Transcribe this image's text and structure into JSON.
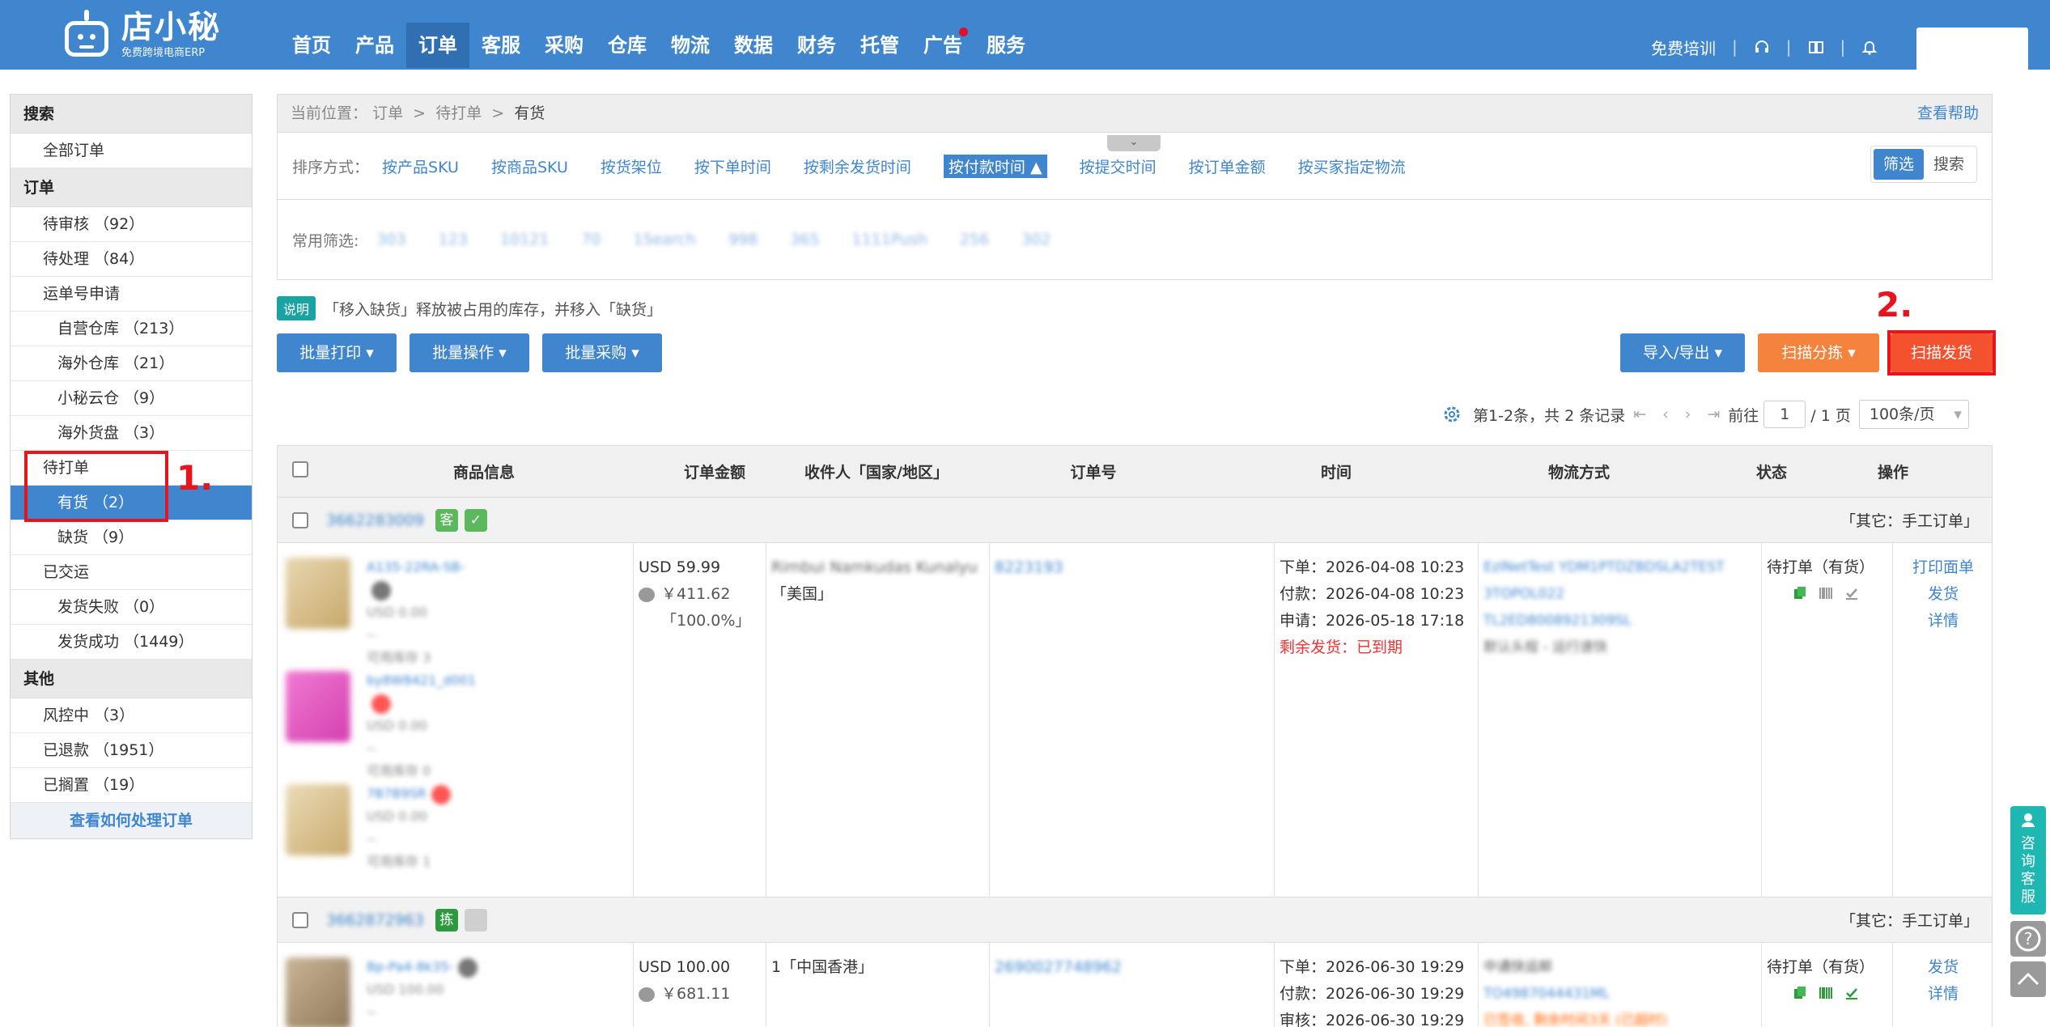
{
  "brand": {
    "name": "店小秘",
    "tagline": "免费跨境电商ERP"
  },
  "nav": {
    "items": [
      "首页",
      "产品",
      "订单",
      "客服",
      "采购",
      "仓库",
      "物流",
      "数据",
      "财务",
      "托管",
      "广告",
      "服务"
    ],
    "active": "订单"
  },
  "topbar": {
    "training": "免费培训"
  },
  "sidebar": {
    "search_head": "搜索",
    "all_orders": "全部订单",
    "orders_head": "订单",
    "pending_review": "待审核 （92）",
    "pending_process": "待处理 （84）",
    "waybill_apply": "运单号申请",
    "own_warehouse": "自营仓库 （213）",
    "overseas_warehouse": "海外仓库 （21）",
    "xiaomi_cloud": "小秘云仓 （9）",
    "overseas_stock": "海外货盘 （3）",
    "to_print": "待打单",
    "in_stock": "有货 （2）",
    "out_of_stock": "缺货 （9）",
    "delivered": "已交运",
    "ship_failed": "发货失败 （0）",
    "ship_success": "发货成功 （1449）",
    "other_head": "其他",
    "risk_control": "风控中 （3）",
    "refunded": "已退款 （1951）",
    "shelved": "已搁置 （19）",
    "how_to_link": "查看如何处理订单"
  },
  "breadcrumb": {
    "prefix": "当前位置：",
    "level1": "订单",
    "sep": ">",
    "level2": "待打单",
    "level3": "有货",
    "help": "查看帮助"
  },
  "sort": {
    "label": "排序方式：",
    "options": [
      "按产品SKU",
      "按商品SKU",
      "按货架位",
      "按下单时间",
      "按剩余发货时间",
      "按付款时间 ▲",
      "按提交时间",
      "按订单金额",
      "按买家指定物流"
    ],
    "active_index": 5,
    "toggle": [
      "筛选",
      "搜索"
    ]
  },
  "filter": {
    "label": "常用筛选:",
    "chips": [
      "303",
      "123",
      "10121",
      "70",
      "1Search",
      "998",
      "365",
      "1111Push",
      "256",
      "302"
    ]
  },
  "note": {
    "tag": "说明",
    "text": "「移入缺货」释放被占用的库存，并移入「缺货」"
  },
  "actions": {
    "batch_print": "批量打印 ▾",
    "batch_ops": "批量操作 ▾",
    "batch_purchase": "批量采购 ▾",
    "import_export": "导入/导出 ▾",
    "scan_sort": "扫描分拣 ▾",
    "scan_ship": "扫描发货"
  },
  "annotations": {
    "step1": "1.",
    "step2": "2."
  },
  "pager": {
    "summary": "第1-2条，共 2 条记录",
    "goto": "前往",
    "page": "1",
    "total": "/ 1 页",
    "per_page": "100条/页"
  },
  "table": {
    "headers": [
      "商品信息",
      "订单金额",
      "收件人「国家/地区」",
      "订单号",
      "时间",
      "物流方式",
      "状态",
      "操作"
    ],
    "groups": [
      {
        "group_id": "3662283009",
        "badges": [
          "客",
          "✓"
        ],
        "source": "「其它：手工订单」",
        "amount": "USD 59.99",
        "cost": "￥411.62",
        "profit": "「100.0%」",
        "recipient_name": "Rimbui Namkudas Kunalyu",
        "country": "「美国」",
        "order_no": "8223193",
        "time_order": "下单：2026-04-08 10:23",
        "time_paid": "付款：2026-04-08 10:23",
        "time_apply": "申请：2026-05-18 17:18",
        "time_left": "剩余发货：已到期",
        "logistics": [
          "EzlNetTest YDM1PTDZBDSLA2TEST",
          "3TOPOL022",
          "TL2ED8008921309SL",
          "默认头程 - 运行速快"
        ],
        "status": "待打单（有货）",
        "ops": [
          "打印面单",
          "发货",
          "详情"
        ],
        "products": [
          {
            "sku": "A135-22RA-SB-",
            "price": "USD 0.00",
            "qty": "--",
            "stock": "可用库存 3"
          },
          {
            "sku": "by8W8421_d001",
            "price": "USD 0.00",
            "qty": "--",
            "stock": "可用库存 0"
          },
          {
            "sku": "7B7B9SR",
            "price": "USD 0.00",
            "qty": "--",
            "stock": "可用库存 1"
          }
        ]
      },
      {
        "group_id": "3662872963",
        "badges": [
          "拣",
          ""
        ],
        "source": "「其它：手工订单」",
        "amount": "USD 100.00",
        "cost": "￥681.11",
        "recipient_name": "1",
        "country": "「中国香港」",
        "order_no": "2690027748962",
        "time_order": "下单：2026-06-30 19:29",
        "time_paid": "付款：2026-06-30 19:29",
        "time_review": "审核：2026-06-30 19:29",
        "logistics": [
          "中通快运邮",
          "TO4987044431ML",
          "已签收, 剩余时间3天 (已超时)"
        ],
        "status": "待打单（有货）",
        "ops": [
          "发货",
          "详情"
        ],
        "products": [
          {
            "sku": "Bp-Pa4-8k35-",
            "price": "USD 100.00",
            "qty": "--",
            "stock": ""
          }
        ]
      }
    ]
  },
  "float": {
    "consult": "咨询客服"
  },
  "colors": {
    "primary": "#3f86ce",
    "orange": "#f6833d",
    "scan_ship": "#f4512f",
    "annotation_red": "#e8141d"
  }
}
